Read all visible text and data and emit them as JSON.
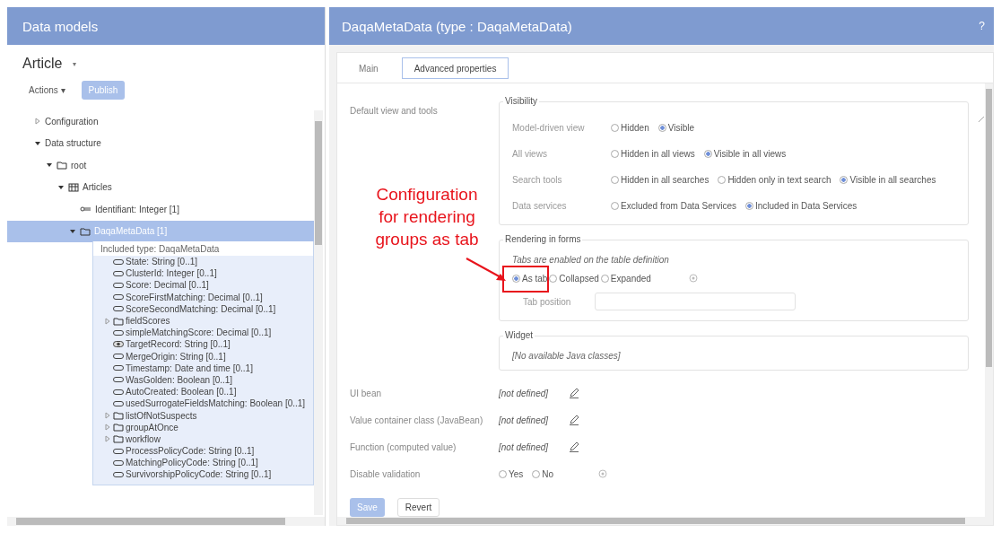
{
  "left_header": {
    "title": "Data models"
  },
  "model": {
    "title": "Article",
    "menu_caret": "▾",
    "actions": "Actions ▾",
    "publish": "Publish"
  },
  "tree": [
    {
      "label": "Configuration",
      "expanded": false,
      "selected": false
    },
    {
      "label": "Data structure",
      "expanded": true,
      "selected": false,
      "children": [
        {
          "label": "root",
          "kind": "folder",
          "expanded": true,
          "selected": false,
          "children": [
            {
              "label": "Articles",
              "kind": "table",
              "expanded": true,
              "selected": false,
              "children": [
                {
                  "label": "Identifiant: Integer  [1]",
                  "kind": "key",
                  "selected": false
                },
                {
                  "label": "DaqaMetaData [1]",
                  "kind": "folder",
                  "expanded": true,
                  "selected": true,
                  "included": {
                    "title": "Included type: DaqaMetaData",
                    "items": [
                      {
                        "label": "State: String  [0..1]",
                        "kind": "field"
                      },
                      {
                        "label": "ClusterId: Integer  [0..1]",
                        "kind": "field"
                      },
                      {
                        "label": "Score: Decimal  [0..1]",
                        "kind": "field"
                      },
                      {
                        "label": "ScoreFirstMatching: Decimal  [0..1]",
                        "kind": "field"
                      },
                      {
                        "label": "ScoreSecondMatching: Decimal  [0..1]",
                        "kind": "field"
                      },
                      {
                        "label": "fieldScores",
                        "kind": "folder",
                        "expanded": false
                      },
                      {
                        "label": "simpleMatchingScore: Decimal  [0..1]",
                        "kind": "field"
                      },
                      {
                        "label": "TargetRecord: String  [0..1]",
                        "kind": "link"
                      },
                      {
                        "label": "MergeOrigin: String  [0..1]",
                        "kind": "field"
                      },
                      {
                        "label": "Timestamp: Date and time  [0..1]",
                        "kind": "field"
                      },
                      {
                        "label": "WasGolden: Boolean  [0..1]",
                        "kind": "field"
                      },
                      {
                        "label": "AutoCreated: Boolean  [0..1]",
                        "kind": "field"
                      },
                      {
                        "label": "usedSurrogateFieldsMatching: Boolean  [0..1]",
                        "kind": "field"
                      },
                      {
                        "label": "listOfNotSuspects",
                        "kind": "folder",
                        "expanded": false
                      },
                      {
                        "label": "groupAtOnce",
                        "kind": "folder",
                        "expanded": false
                      },
                      {
                        "label": "workflow",
                        "kind": "folder",
                        "expanded": false
                      },
                      {
                        "label": "ProcessPolicyCode: String  [0..1]",
                        "kind": "field"
                      },
                      {
                        "label": "MatchingPolicyCode: String  [0..1]",
                        "kind": "field"
                      },
                      {
                        "label": "SurvivorshipPolicyCode: String  [0..1]",
                        "kind": "field"
                      }
                    ]
                  }
                }
              ]
            }
          ]
        }
      ]
    }
  ],
  "right_header": {
    "title": "DaqaMetaData (type : DaqaMetaData)",
    "help": "?"
  },
  "tabs": [
    {
      "label": "Main",
      "selected": false
    },
    {
      "label": "Advanced properties",
      "selected": true
    }
  ],
  "default_view": {
    "label": "Default view and tools",
    "group": "Visibility",
    "rows": [
      {
        "label": "Model-driven view",
        "options": [
          {
            "label": "Hidden",
            "selected": false
          },
          {
            "label": "Visible",
            "selected": true
          }
        ]
      },
      {
        "label": "All views",
        "options": [
          {
            "label": "Hidden in all views",
            "selected": false
          },
          {
            "label": "Visible in all views",
            "selected": true
          }
        ]
      },
      {
        "label": "Search tools",
        "options": [
          {
            "label": "Hidden in all searches",
            "selected": false
          },
          {
            "label": "Hidden only in text search",
            "selected": false
          },
          {
            "label": "Visible in all searches",
            "selected": true
          }
        ]
      },
      {
        "label": "Data services",
        "options": [
          {
            "label": "Excluded from Data Services",
            "selected": false
          },
          {
            "label": "Included in Data Services",
            "selected": true
          }
        ]
      }
    ]
  },
  "rendering": {
    "group": "Rendering in forms",
    "note": "Tabs are enabled on the table definition",
    "options": [
      {
        "label": "As tab",
        "selected": true
      },
      {
        "label": "Collapsed",
        "selected": false
      },
      {
        "label": "Expanded",
        "selected": false
      }
    ],
    "tab_position": {
      "label": "Tab position"
    }
  },
  "widget": {
    "group": "Widget",
    "text": "[No available Java classes]"
  },
  "properties": [
    {
      "label": "UI bean",
      "value": "[not defined]"
    },
    {
      "label": "Value container class (JavaBean)",
      "value": "[not defined]"
    },
    {
      "label": "Function (computed value)",
      "value": "[not defined]"
    }
  ],
  "disable_validation": {
    "label": "Disable validation",
    "options": [
      {
        "label": "Yes",
        "selected": false
      },
      {
        "label": "No",
        "selected": false
      }
    ]
  },
  "buttons": [
    {
      "label": "Save",
      "kind": "primary"
    },
    {
      "label": "Revert",
      "kind": "secondary"
    }
  ],
  "annotation": {
    "text": "Configuration for rendering groups as tab"
  }
}
